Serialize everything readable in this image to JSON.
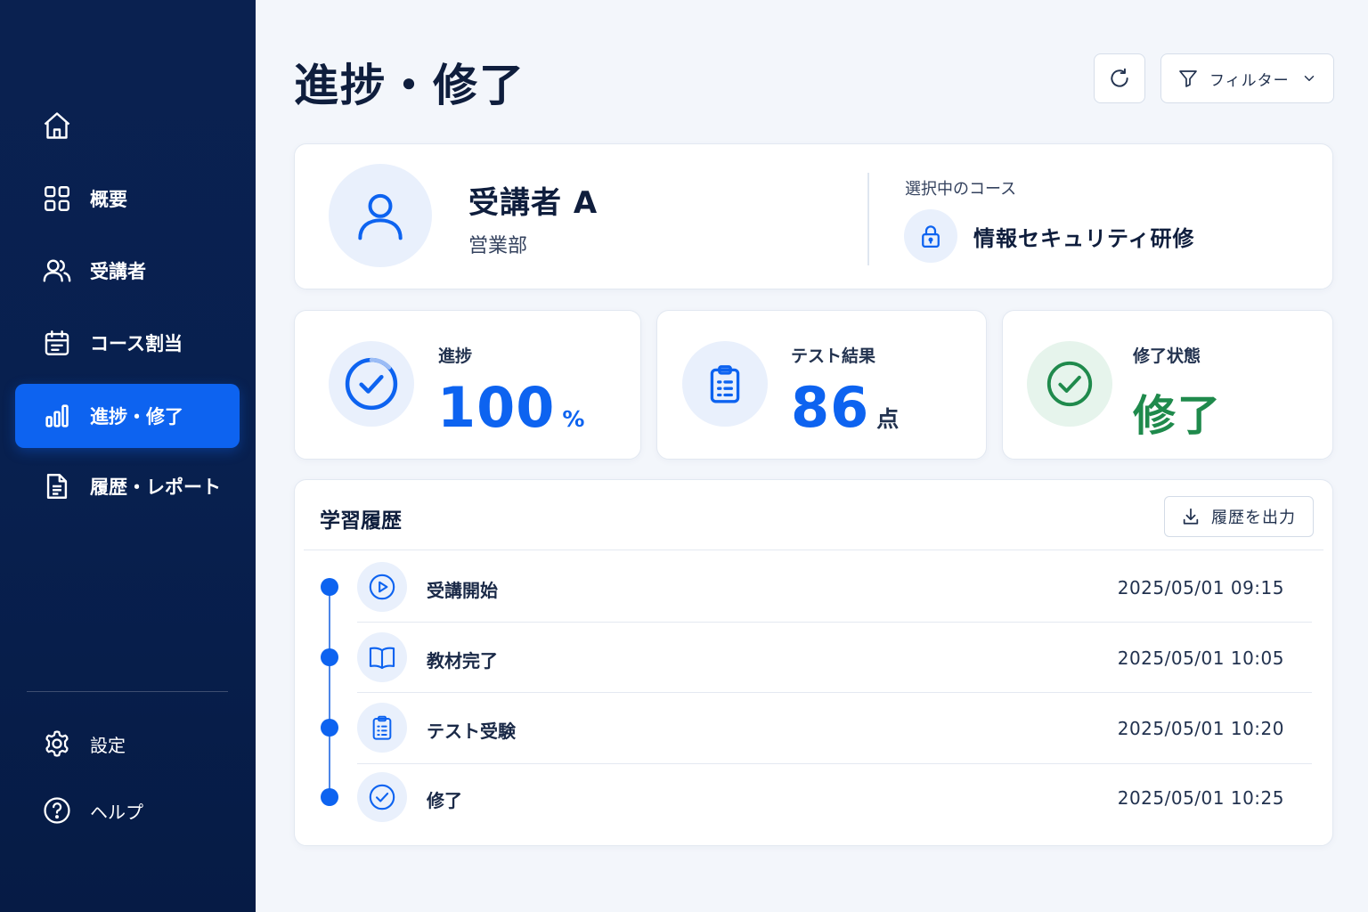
{
  "sidebar": {
    "home_icon": "home-icon",
    "items": [
      {
        "label": "概要",
        "icon": "grid-icon"
      },
      {
        "label": "受講者",
        "icon": "users-icon"
      },
      {
        "label": "コース割当",
        "icon": "calendar-icon"
      },
      {
        "label": "進捗・修了",
        "icon": "bar-chart-icon",
        "active": true
      },
      {
        "label": "履歴・レポート",
        "icon": "document-icon"
      }
    ],
    "bottom_items": [
      {
        "label": "設定",
        "icon": "gear-icon"
      },
      {
        "label": "ヘルプ",
        "icon": "help-icon"
      }
    ]
  },
  "header": {
    "title": "進捗・修了",
    "filter_label": "フィルター"
  },
  "profile": {
    "name": "受講者 A",
    "department": "営業部",
    "course_label": "選択中のコース",
    "course_name": "情報セキュリティ研修"
  },
  "stats": {
    "progress": {
      "label": "進捗",
      "value": "100",
      "unit": "%"
    },
    "test": {
      "label": "テスト結果",
      "value": "86",
      "unit": "点"
    },
    "completion": {
      "label": "修了状態",
      "value": "修了"
    }
  },
  "history": {
    "title": "学習履歴",
    "export_label": "履歴を出力",
    "entries": [
      {
        "label": "受講開始",
        "time": "2025/05/01  09:15",
        "icon": "play-icon"
      },
      {
        "label": "教材完了",
        "time": "2025/05/01  10:05",
        "icon": "book-icon"
      },
      {
        "label": "テスト受験",
        "time": "2025/05/01  10:20",
        "icon": "clipboard-icon"
      },
      {
        "label": "修了",
        "time": "2025/05/01  10:25",
        "icon": "check-circle-icon"
      }
    ]
  },
  "colors": {
    "sidebar_bg": "#0a2150",
    "accent": "#0d63f0",
    "success": "#1f8a4c",
    "page_bg": "#f3f6fb"
  }
}
